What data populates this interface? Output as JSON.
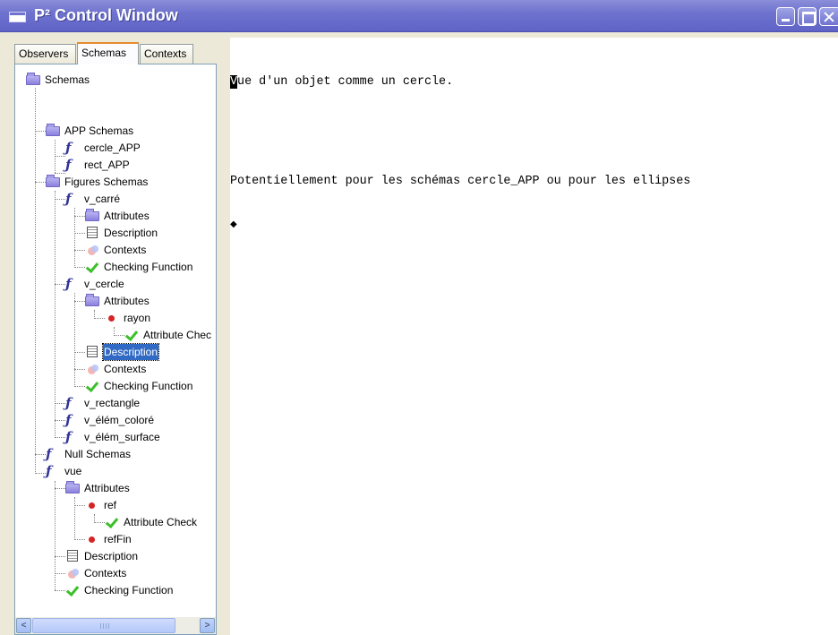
{
  "window": {
    "title": "P² Control Window"
  },
  "tabs": [
    {
      "label": "Observers"
    },
    {
      "label": "Schemas"
    },
    {
      "label": "Contexts"
    }
  ],
  "tree": {
    "root": "Schemas",
    "app_schemas": "APP Schemas",
    "cercle_app": "cercle_APP",
    "rect_app": "rect_APP",
    "figures_schemas": "Figures Schemas",
    "v_carre": "v_carré",
    "v_carre_attributes": "Attributes",
    "v_carre_description": "Description",
    "v_carre_contexts": "Contexts",
    "v_carre_checking": "Checking Function",
    "v_cercle": "v_cercle",
    "v_cercle_attributes": "Attributes",
    "rayon": "rayon",
    "rayon_check": "Attribute Chec",
    "v_cercle_description": "Description",
    "v_cercle_contexts": "Contexts",
    "v_cercle_checking": "Checking Function",
    "v_rectangle": "v_rectangle",
    "v_elem_colore": "v_élém_coloré",
    "v_elem_surface": "v_élém_surface",
    "null_schemas": "Null Schemas",
    "vue": "vue",
    "vue_attributes": "Attributes",
    "ref": "ref",
    "ref_check": "Attribute Check",
    "reffin": "refFin",
    "vue_description": "Description",
    "vue_contexts": "Contexts",
    "vue_checking": "Checking Function"
  },
  "editor": {
    "first_char": "V",
    "line1_rest": "ue d'un objet comme un cercle.",
    "line3": "Potentiellement pour les schémas cercle_APP ou pour les ellipses",
    "marker": "◆"
  },
  "scrollbar": {
    "left_arrow": "<",
    "right_arrow": ">"
  },
  "colors": {
    "titlebar": "#6f73cf",
    "selection": "#316ac5",
    "active_tab_accent": "#e68b2c"
  }
}
